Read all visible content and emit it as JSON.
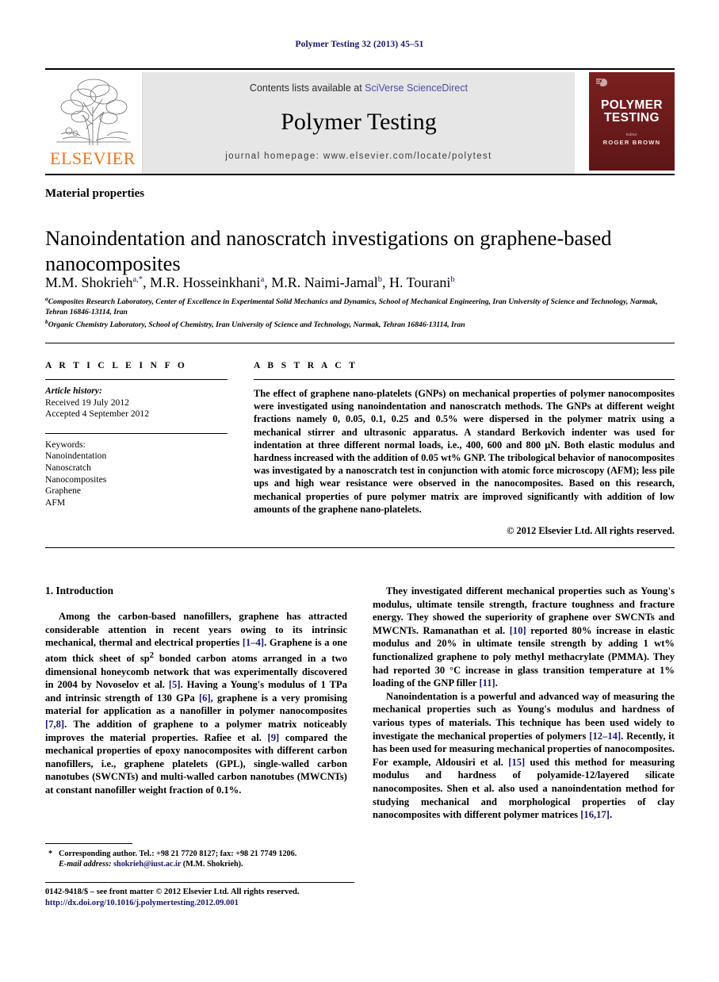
{
  "running_head": "Polymer Testing 32 (2013) 45–51",
  "masthead": {
    "contents_prefix": "Contents lists available at ",
    "sciencedirect": "SciVerse ScienceDirect",
    "journal_title": "Polymer Testing",
    "homepage": "journal homepage: www.elsevier.com/locate/polytest",
    "publisher_name": "ELSEVIER",
    "cover": {
      "line1": "POLYMER",
      "line2": "TESTING",
      "editor_label": "Editor",
      "editor_name": "ROGER BROWN"
    },
    "link_color": "#4a4aa8",
    "brand_color": "#e87722",
    "cover_color": "#6e1c1c"
  },
  "section_label": "Material properties",
  "title": "Nanoindentation and nanoscratch investigations on graphene-based nanocomposites",
  "authors": [
    {
      "name": "M.M. Shokrieh",
      "marks": "a,*"
    },
    {
      "name": "M.R. Hosseinkhani",
      "marks": "a"
    },
    {
      "name": "M.R. Naimi-Jamal",
      "marks": "b"
    },
    {
      "name": "H. Tourani",
      "marks": "b"
    }
  ],
  "affiliations": [
    {
      "mark": "a",
      "text": "Composites Research Laboratory, Center of Excellence in Experimental Solid Mechanics and Dynamics, School of Mechanical Engineering, Iran University of Science and Technology, Narmak, Tehran 16846-13114, Iran"
    },
    {
      "mark": "b",
      "text": "Organic Chemistry Laboratory, School of Chemistry, Iran University of Science and Technology, Narmak, Tehran 16846-13114, Iran"
    }
  ],
  "article_info": {
    "heading": "A R T I C L E   I N F O",
    "history_label": "Article history:",
    "received": "Received 19 July 2012",
    "accepted": "Accepted 4 September 2012",
    "keywords_label": "Keywords:",
    "keywords": [
      "Nanoindentation",
      "Nanoscratch",
      "Nanocomposites",
      "Graphene",
      "AFM"
    ]
  },
  "abstract": {
    "heading": "A B S T R A C T",
    "text": "The effect of graphene nano-platelets (GNPs) on mechanical properties of polymer nanocomposites were investigated using nanoindentation and nanoscratch methods. The GNPs at different weight fractions namely 0, 0.05, 0.1, 0.25 and 0.5% were dispersed in the polymer matrix using a mechanical stirrer and ultrasonic apparatus. A standard Berkovich indenter was used for indentation at three different normal loads, i.e., 400, 600 and 800 μN. Both elastic modulus and hardness increased with the addition of 0.05 wt% GNP. The tribological behavior of nanocomposites was investigated by a nanoscratch test in conjunction with atomic force microscopy (AFM); less pile ups and high wear resistance were observed in the nanocomposites. Based on this research, mechanical properties of pure polymer matrix are improved significantly with addition of low amounts of the graphene nano-platelets.",
    "copyright": "© 2012 Elsevier Ltd. All rights reserved."
  },
  "body": {
    "intro_heading": "1. Introduction",
    "left_paragraphs": [
      "Among the carbon-based nanofillers, graphene has attracted considerable attention in recent years owing to its intrinsic mechanical, thermal and electrical properties [1–4]. Graphene is a one atom thick sheet of sp2 bonded carbon atoms arranged in a two dimensional honeycomb network that was experimentally discovered in 2004 by Novoselov et al. [5]. Having a Young's modulus of 1 TPa and intrinsic strength of 130 GPa [6], graphene is a very promising material for application as a nanofiller in polymer nanocomposites [7,8]. The addition of graphene to a polymer matrix noticeably improves the material properties. Rafiee et al. [9] compared the mechanical properties of epoxy nanocomposites with different carbon nanofillers, i.e., graphene platelets (GPL), single-walled carbon nanotubes (SWCNTs) and multi-walled carbon nanotubes (MWCNTs) at constant nanofiller weight fraction of 0.1%."
    ],
    "right_paragraphs": [
      "They investigated different mechanical properties such as Young's modulus, ultimate tensile strength, fracture toughness and fracture energy. They showed the superiority of graphene over SWCNTs and MWCNTs. Ramanathan et al. [10] reported 80% increase in elastic modulus and 20% in ultimate tensile strength by adding 1 wt% functionalized graphene to poly methyl methacrylate (PMMA). They had reported 30 °C increase in glass transition temperature at 1% loading of the GNP filler [11].",
      "Nanoindentation is a powerful and advanced way of measuring the mechanical properties such as Young's modulus and hardness of various types of materials. This technique has been used widely to investigate the mechanical properties of polymers [12–14]. Recently, it has been used for measuring mechanical properties of nanocomposites. For example, Aldousiri et al. [15] used this method for measuring modulus and hardness of polyamide-12/layered silicate nanocomposites. Shen et al. also used a nanoindentation method for studying mechanical and morphological properties of clay nanocomposites with different polymer matrices [16,17]."
    ]
  },
  "footnote": {
    "star": "*",
    "corresponding": "Corresponding author. Tel.: +98 21 7720 8127; fax: +98 21 7749 1206.",
    "email_label": "E-mail address:",
    "email": "shokrieh@iust.ac.ir",
    "email_owner": "(M.M. Shokrieh)."
  },
  "imprint": {
    "issn_line": "0142-9418/$ – see front matter © 2012 Elsevier Ltd. All rights reserved.",
    "doi": "http://dx.doi.org/10.1016/j.polymertesting.2012.09.001"
  }
}
